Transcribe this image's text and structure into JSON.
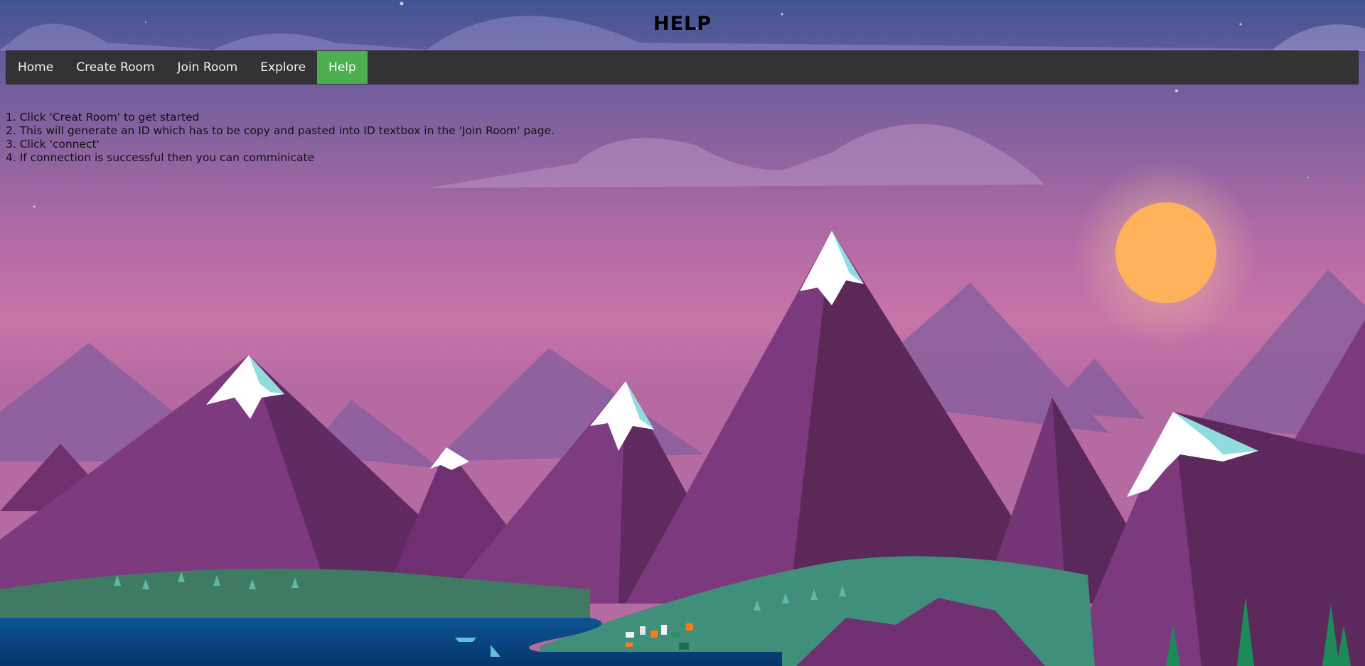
{
  "page": {
    "title": "HELP"
  },
  "nav": {
    "items": [
      {
        "label": "Home"
      },
      {
        "label": "Create Room"
      },
      {
        "label": "Join Room"
      },
      {
        "label": "Explore"
      },
      {
        "label": "Help"
      }
    ],
    "active": "Help",
    "active_color": "#4caf50",
    "bar_color": "#333333"
  },
  "help": {
    "steps": [
      "1. Click 'Creat Room' to get started",
      "2. This will generate an ID which has to be copy and pasted into ID textbox in the 'Join Room' page.",
      "3. Click 'connect'",
      "4. If connection is successful then you can comminicate"
    ]
  },
  "background": {
    "scene": "mountain-landscape-wallpaper",
    "sun_color": "#ffb25a",
    "sky_colors": [
      "#3f5593",
      "#8a639f",
      "#c874a7"
    ],
    "mountain_color": "#7a3a7a",
    "lake_color": "#0b4a8a"
  }
}
